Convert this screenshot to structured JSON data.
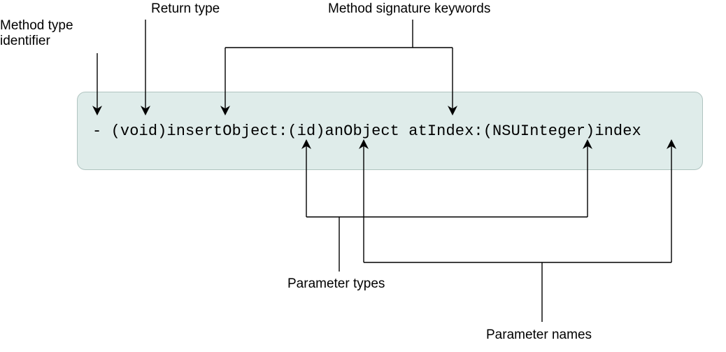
{
  "labels": {
    "method_type_identifier": "Method type\nidentifier",
    "return_type": "Return type",
    "method_signature_keywords": "Method signature keywords",
    "parameter_types": "Parameter types",
    "parameter_names": "Parameter names"
  },
  "code": {
    "line": "- (void)insertObject:(id)anObject atIndex:(NSUInteger)index"
  },
  "diagram": {
    "box_color": "#dfecea",
    "border_color": "#b0c4c0",
    "arrows": [
      {
        "name": "method-type-identifier",
        "target": "-"
      },
      {
        "name": "return-type",
        "target": "(void)"
      },
      {
        "name": "method-signature-keywords",
        "targets": [
          "insertObject:",
          "atIndex:"
        ]
      },
      {
        "name": "parameter-types",
        "targets": [
          "(id)",
          "(NSUInteger)"
        ]
      },
      {
        "name": "parameter-names",
        "targets": [
          "anObject",
          "index"
        ]
      }
    ]
  }
}
